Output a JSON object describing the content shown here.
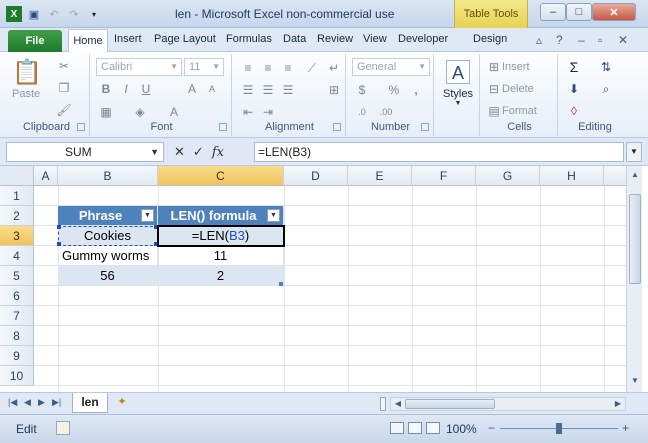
{
  "window": {
    "title": "len  -  Microsoft Excel non-commercial use",
    "context_tab": "Table Tools",
    "minimize": "–",
    "maximize": "□",
    "close": "✕"
  },
  "ribbon_tabs": {
    "file": "File",
    "home": "Home",
    "insert": "Insert",
    "page_layout": "Page Layout",
    "formulas": "Formulas",
    "data": "Data",
    "review": "Review",
    "view": "View",
    "developer": "Developer",
    "design": "Design"
  },
  "ribbon": {
    "clipboard": {
      "label": "Clipboard",
      "paste": "Paste"
    },
    "font": {
      "label": "Font",
      "font_name": "Calibri",
      "font_size": "11"
    },
    "alignment": {
      "label": "Alignment"
    },
    "number": {
      "label": "Number",
      "format": "General",
      "percent": "%",
      "comma": ",",
      "currency": "$"
    },
    "styles": {
      "label": "Styles"
    },
    "cells": {
      "label": "Cells",
      "insert": "Insert",
      "delete": "Delete",
      "format": "Format"
    },
    "editing": {
      "label": "Editing"
    }
  },
  "formula_bar": {
    "name_box": "SUM",
    "formula": "=LEN(B3)"
  },
  "sheet": {
    "columns": [
      "A",
      "B",
      "C",
      "D",
      "E",
      "F",
      "G",
      "H"
    ],
    "rows": [
      "1",
      "2",
      "3",
      "4",
      "5",
      "6",
      "7",
      "8",
      "9",
      "10"
    ],
    "headers": {
      "b2": "Phrase",
      "c2": "LEN() formula"
    },
    "cells": {
      "b3": "Cookies",
      "c3_prefix": "=LEN(",
      "c3_ref": "B3",
      "c3_suffix": ")",
      "b4": "Gummy worms",
      "c4": "11",
      "b5": "56",
      "c5": "2"
    },
    "table_header_color": "#4f81bd",
    "table_band_color": "#dce6f1"
  },
  "sheet_tabs": {
    "active": "len"
  },
  "status": {
    "mode": "Edit",
    "zoom": "100%",
    "zoom_out": "−",
    "zoom_in": "+"
  }
}
